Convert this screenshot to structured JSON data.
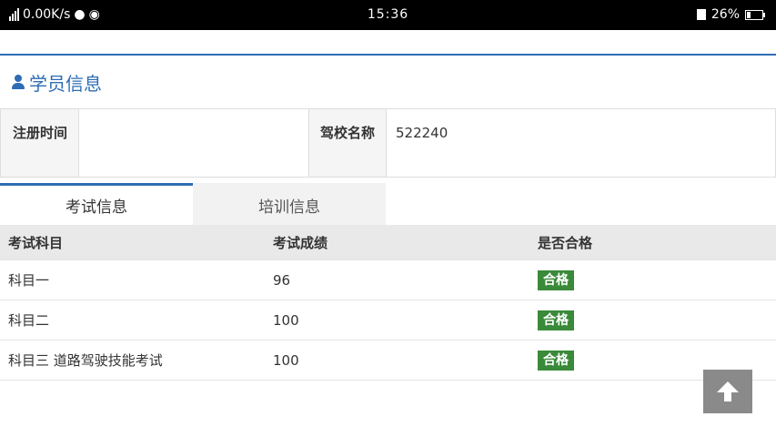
{
  "status_bar": {
    "net_speed": "0.00K/s",
    "time": "15:36",
    "battery": "26%"
  },
  "section": {
    "title": "学员信息",
    "icon": "user-icon"
  },
  "info": {
    "reg_time_label": "注册时间",
    "reg_time_value": "",
    "school_label": "驾校名称",
    "school_value": "522240"
  },
  "tabs": [
    {
      "label": "考试信息",
      "active": true
    },
    {
      "label": "培训信息",
      "active": false
    }
  ],
  "results": {
    "headers": [
      "考试科目",
      "考试成绩",
      "是否合格"
    ],
    "rows": [
      {
        "subject": "科目一",
        "score": "96",
        "pass": "合格"
      },
      {
        "subject": "科目二",
        "score": "100",
        "pass": "合格"
      },
      {
        "subject": "科目三 道路驾驶技能考试",
        "score": "100",
        "pass": "合格"
      }
    ]
  },
  "colors": {
    "accent": "#2e6db4",
    "pass_badge": "#3a8a3a",
    "to_top_button": "#8a8a8a"
  },
  "to_top_icon": "arrow-up-icon"
}
